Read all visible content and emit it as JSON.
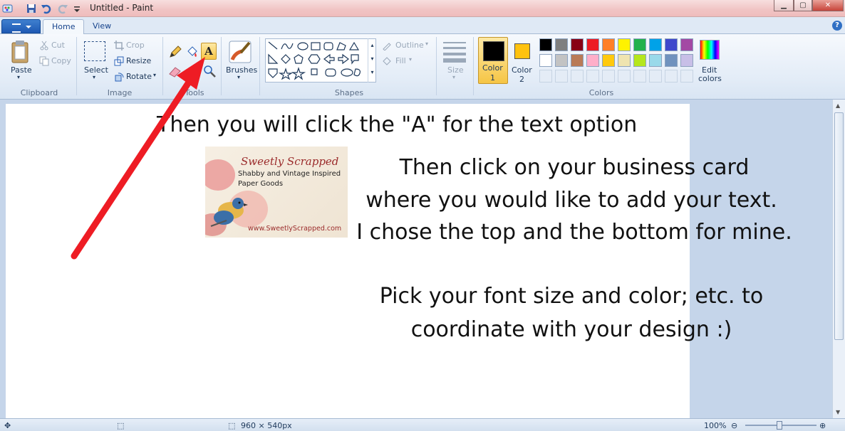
{
  "window": {
    "title": "Untitled - Paint"
  },
  "tabs": [
    "Home",
    "View"
  ],
  "clipboard": {
    "paste": "Paste",
    "cut": "Cut",
    "copy": "Copy",
    "group": "Clipboard"
  },
  "image": {
    "select": "Select",
    "crop": "Crop",
    "resize": "Resize",
    "rotate": "Rotate",
    "group": "Image"
  },
  "tools": {
    "group": "Tools"
  },
  "brushes": {
    "label": "Brushes"
  },
  "shapes": {
    "outline": "Outline",
    "fill": "Fill",
    "group": "Shapes"
  },
  "size": {
    "label": "Size"
  },
  "colors": {
    "color1": "Color",
    "color1_num": "1",
    "color2": "Color",
    "color2_num": "2",
    "edit": "Edit",
    "edit2": "colors",
    "group": "Colors",
    "color1_value": "#000000",
    "color2_value": "#ffc20e",
    "palette_row1": [
      "#000000",
      "#7f7f7f",
      "#880015",
      "#ed1c24",
      "#ff7f27",
      "#fff200",
      "#22b14c",
      "#00a2e8",
      "#3f48cc",
      "#a349a4"
    ],
    "palette_row2": [
      "#ffffff",
      "#c3c3c3",
      "#b97a57",
      "#ffaec9",
      "#ffc90e",
      "#efe4b0",
      "#b5e61d",
      "#99d9ea",
      "#7092be",
      "#c8bfe7"
    ]
  },
  "canvas_text": {
    "line1": "Then you will click the \"A\" for the text option",
    "line2": "Then click on your business card",
    "line3": "where you would like to add your text.",
    "line4": "I chose the top and the bottom for mine.",
    "line5": "Pick your font size and color; etc. to",
    "line6": "coordinate with your design :)"
  },
  "card": {
    "title": "Sweetly Scrapped",
    "sub1": "Shabby and Vintage Inspired",
    "sub2": "Paper Goods",
    "url": "www.SweetlyScrapped.com"
  },
  "status": {
    "dimensions": "960 × 540px",
    "zoom": "100%"
  }
}
